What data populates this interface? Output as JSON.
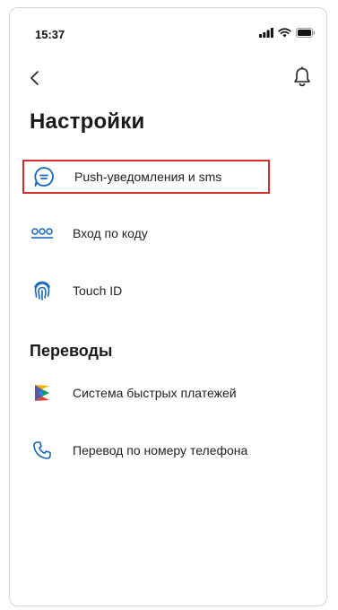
{
  "status_bar": {
    "time": "15:37"
  },
  "header": {
    "back_icon": "chevron-left-icon",
    "bell_icon": "bell-icon"
  },
  "page": {
    "title": "Настройки"
  },
  "settings_items": [
    {
      "label": "Push-уведомления и sms",
      "icon": "message-icon",
      "highlighted": true
    },
    {
      "label": "Вход по коду",
      "icon": "code-dots-icon"
    },
    {
      "label": "Touch ID",
      "icon": "fingerprint-icon"
    }
  ],
  "transfers_section": {
    "title": "Переводы",
    "items": [
      {
        "label": "Система быстрых платежей",
        "icon": "sbp-logo-icon"
      },
      {
        "label": "Перевод по номеру телефона",
        "icon": "phone-icon"
      }
    ]
  },
  "colors": {
    "accent": "#1565c0",
    "highlight_border": "#d32f2f"
  }
}
